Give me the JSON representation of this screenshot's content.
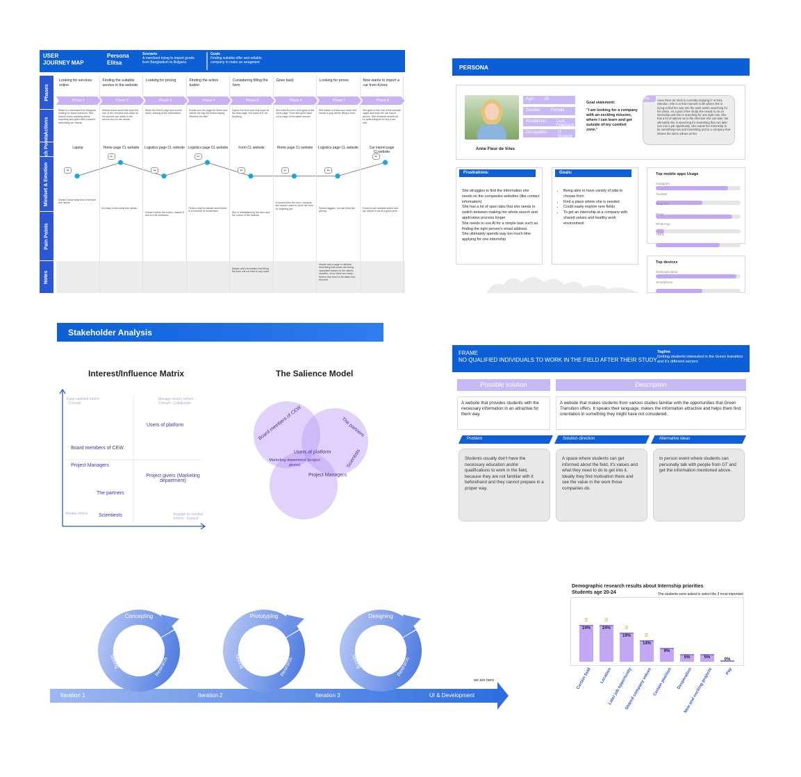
{
  "journey": {
    "title_line1": "USER",
    "title_line2": "JOURNEY MAP",
    "persona_label": "Persona",
    "persona_name": "Elitsa",
    "scenario_label": "Scenario",
    "scenario_text": "A merchant trying to import goods from Bangladesh to Bulgaria",
    "goals_label": "Goals",
    "goals_text": "Finding suitable offer and reliable company to make an arragment",
    "rows": [
      "Phases",
      "Actions",
      "Touch Points",
      "Mindset & Emotion",
      "Pain Points",
      "Notes"
    ],
    "phases": [
      {
        "title": "Looking for services online",
        "tag": "Phase 1",
        "action": "Elitsa is a merchant from Bulgaria looking for import services. She doesn't know anything about importing and goes with a search describing her needs.",
        "touch": "Laptop",
        "pain": "Doesn't know what kind of service she needs",
        "note": ""
      },
      {
        "title": "Finding the suitable service in the website",
        "tag": "Phase 2",
        "action": "Without some scroll she sees the icon of the services and clicks on the second one which is the correct one for her needs.",
        "touch": "Home page CL website",
        "pain": "It's easy to find what she needs.",
        "note": ""
      },
      {
        "title": "Looking for pricing",
        "tag": "Phase 3",
        "action": "Skips the Home page and scrolls down, looking at the information.",
        "touch": "Logistics page CL website",
        "pain": "Doesn't notice the button, misses it and is a bit confused.",
        "note": ""
      },
      {
        "title": "Finding the action button",
        "tag": "Phase 4",
        "action": "Scrolls over the page for times and notices the big red button saying \"Receive an offer\"",
        "touch": "Logistics page CL website",
        "pain": "Finds a way to interact and it there is a moment of excitement.",
        "note": ""
      },
      {
        "title": "Considering filling the form",
        "tag": "Phase 5",
        "action": "Opens the form and only looks at the final page, but does NOT do anything.",
        "touch": "Form CL website",
        "pain": "She is intimidated by the form and the colour of the buttons.",
        "note": "Maybe add information that filling the form will not lead to any costs."
      },
      {
        "title": "Goes back",
        "tag": "Phase 6",
        "action": "She exits the form. And goes to the home page. Then she goes back to the page of the same service.",
        "touch": "Home page CL website",
        "pain": "Is scared from the form, because she doesn't want to solve the form for anything yet.",
        "note": ""
      },
      {
        "title": "Looking for prices",
        "tag": "Phase 7",
        "action": "She wants to know how much she needs to pay before filling a form.",
        "touch": "Logistics page CL website",
        "pain": "Seems laggish, but can't find the pricing.",
        "note": "Maybe add a page or window describing that prices are being calculated based on the client's situation, since there are many factors that need to be taken into account."
      },
      {
        "title": "Now wants to import a car from Korea",
        "tag": "Phase 8",
        "action": "She goes to the rest of the website pages and finds the car import service. She distracts herself but it's quite intrigued to buy a car now.",
        "touch": "Car import page CLwebsite",
        "pain": "Found a nice website where she can import a car at a good price.",
        "note": ""
      }
    ],
    "emotion_levels": [
      0.3,
      1,
      0.3,
      1,
      0.3,
      0.3,
      0.3,
      1
    ]
  },
  "persona": {
    "header": "PERSONA",
    "name": "Anne Fleur de Vries",
    "fields": [
      {
        "label": "Age:",
        "value": "20"
      },
      {
        "label": "Gender:",
        "value": "Female"
      },
      {
        "label": "Residence:",
        "value": "Lwd, Friesland"
      },
      {
        "label": "Occupation:",
        "value": "IT Student"
      }
    ],
    "goal_statement_label": "Goal statement:",
    "goal_statement": "\"I am looking for a company with an exciting mission, where I can learn and get outside of my comfort zone.\"",
    "bio_label": "Bio",
    "bio": "Anne Fleur de Vries is currently studying IT at NHL Stenden. She is in that moment in life where she is trying to find her way into the work world, searching for her place. As a part of her study she needs to do an internship and she is searching for one right now. She has a lot of options as to the direction she can take, but ultimately she is searching for something that can later turn into a job opportunity. She wants her internship to be something new and interesting and in a company that shares the same values as her.",
    "frustrations_label": "Frustrations:",
    "frustrations": "She struggles to find the information she needs on the companies websites (like contact information)\nShe has a lot of open tabs that she needs to switch between making her whole search and application process longer\nShe needs to use AI for a simple task such as finding the right person's email address\nShe ultimately spends way too much time applying for one internship",
    "goals_label": "Goals:",
    "goals": [
      "Being able to have variety of jobs to choose from",
      "Find a place where she is needed",
      "Could easily explore new fields",
      "To get an internship at a company with shared values and healthy work environment"
    ],
    "apps_label": "Top mobile apps Usage",
    "apps": [
      {
        "name": "Instagram",
        "level": 0.85
      },
      {
        "name": "Youtube",
        "level": 0.55
      },
      {
        "name": "Snapchat",
        "level": 0.9
      },
      {
        "name": "Email",
        "level": 0.1
      },
      {
        "name": "WhatsApp",
        "level": 0.75
      },
      {
        "name": "Tiktok",
        "level": 0.6
      }
    ],
    "devices_label": "Top devices",
    "devices": [
      {
        "name": "Desktop/Laptop",
        "level": 0.95
      },
      {
        "name": "Smartphone",
        "level": 0.55
      }
    ]
  },
  "stakeholder": {
    "header": "Stakeholder Analysis",
    "matrix_title": "Interest/Influence Matrix",
    "salience_title": "The Salience Model",
    "quadrants": {
      "tl": "Keep satisfied Inform - Consult",
      "tr": "Manage closely Inform - Consult - Collaborate",
      "bl": "Monitor Inform",
      "br": "Engage as needed Inform - Consult"
    },
    "matrix_items": [
      "Users of platform",
      "Board members of CEW",
      "Project Managers",
      "Project givers (Marketing department)",
      "The partners",
      "Scientiests"
    ],
    "salience_items": [
      "Board members of CEW",
      "The partners",
      "Users of platform",
      "Marketing department (project givers)",
      "Scientists",
      "Project Managers"
    ]
  },
  "frame": {
    "label": "FRAME",
    "statement": "NO QUALIFIED INDIVIDUALS TO WORK IN THE FIELD AFTER THEIR STUDY",
    "tagline_label": "Tagline",
    "tagline": "Getting students interested in the Green transition and it's different sectors",
    "possible_solution_label": "Possible solution",
    "description_label": "Description",
    "possible_solution": "A website that provides students with the necessary information in an attractive for them way.",
    "description": "A website that makes students from various studies familiar with the opportunities that Green Transition offers. It speaks their language, makes the information attractive and helps them find orientation in something they might have not considered.",
    "problem_label": "Problem",
    "direction_label": "Solution direction",
    "alt_label": "Alternative ideas",
    "problem": "Students usually don't have the necessary education and/or qualifications to work in the field, because they are not familiar with it beforehand and they cannot prepare in a proper way.",
    "direction": "A space where students can get informed about the field, it's values and what they need to do to get into it. Ideally they find motivation there and see the value in the work those companies do.",
    "alt": "In person event where students can personally talk with people from GT and get the information mentioned above."
  },
  "process": {
    "cycles": [
      {
        "top": "Concepting",
        "left": "Testing",
        "right": "Research"
      },
      {
        "top": "Prototyping",
        "left": "Testing",
        "right": "Research"
      },
      {
        "top": "Designing",
        "left": "Testing",
        "right": "Research"
      }
    ],
    "iterations": [
      "Iteration 1",
      "Iteration 2",
      "Iteration 3",
      "UI & Development"
    ],
    "we_are_here": "we are here"
  },
  "chart_data": {
    "type": "bar",
    "title": "Demographic research results about Internship priorities",
    "subtitle": "Students age 20-24",
    "note": "The students were asked to select the 3 most important",
    "categories": [
      "Certain field",
      "Location",
      "Later job opportunity",
      "Shared company values",
      "Certain position",
      "Desperation",
      "New and exciting projects",
      "Pay"
    ],
    "values": [
      24,
      24,
      19,
      14,
      9,
      5,
      5,
      0
    ],
    "labels": [
      "24%",
      "24%",
      "19%",
      "14%",
      "9%",
      "5%",
      "5%",
      "0%"
    ],
    "ylim": [
      0,
      30
    ]
  }
}
